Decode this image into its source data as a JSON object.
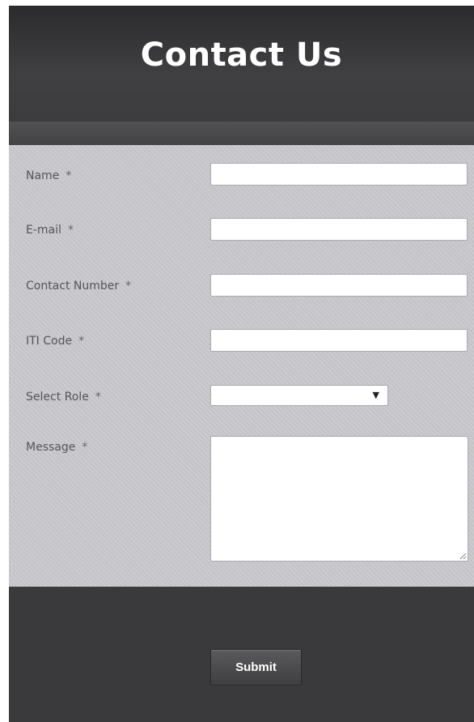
{
  "header": {
    "title": "Contact Us"
  },
  "form": {
    "fields": [
      {
        "label": "Name",
        "required_marker": "*",
        "value": ""
      },
      {
        "label": "E-mail",
        "required_marker": "*",
        "value": ""
      },
      {
        "label": "Contact Number",
        "required_marker": "*",
        "value": ""
      },
      {
        "label": "ITI Code",
        "required_marker": "*",
        "value": ""
      }
    ],
    "role": {
      "label": "Select Role",
      "required_marker": "*",
      "selected": "",
      "arrow_icon": "dropdown-arrow-icon",
      "arrow_glyph": "▼"
    },
    "message": {
      "label": "Message",
      "required_marker": "*",
      "value": ""
    },
    "submit_label": "Submit"
  },
  "colors": {
    "header_bg": "#3a3a3c",
    "form_bg": "#c9c9cd",
    "label_text": "#555558",
    "title_text": "#ffffff"
  }
}
